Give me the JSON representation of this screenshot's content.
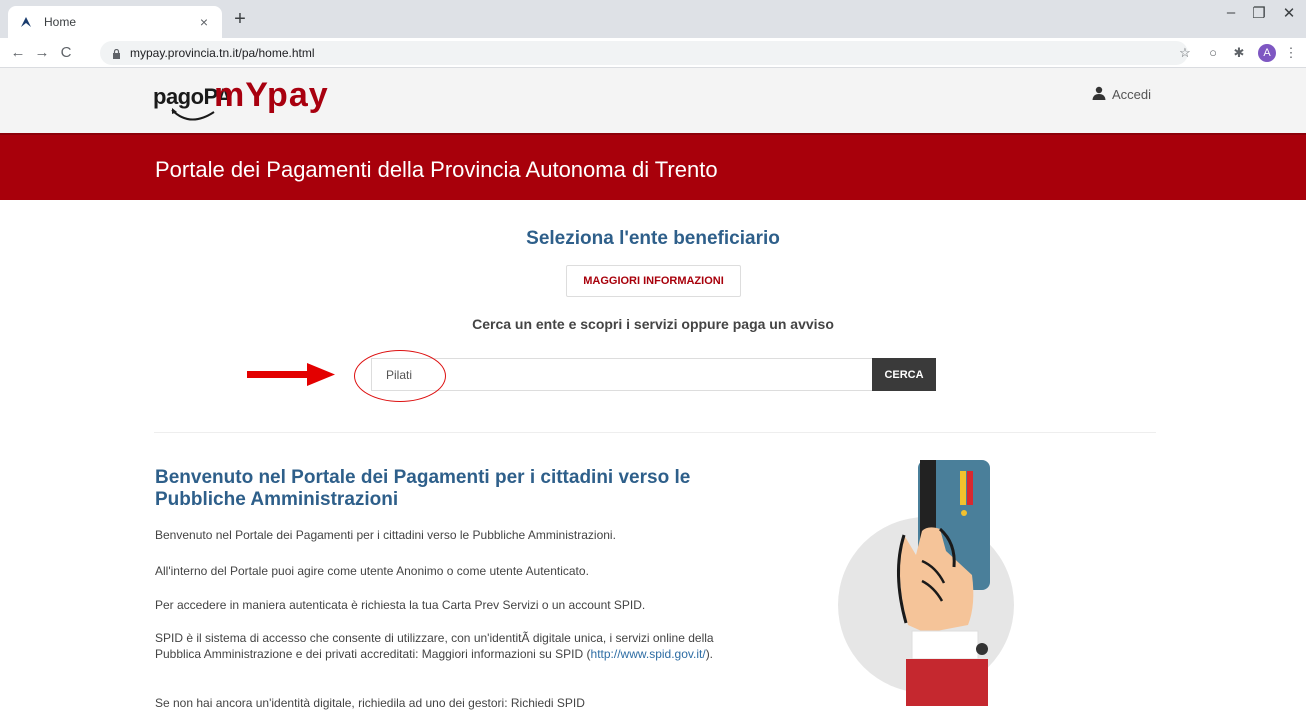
{
  "browser": {
    "tab_title": "Home",
    "tab_close": "×",
    "new_tab": "+",
    "url": "mypay.provincia.tn.it/pa/home.html",
    "profile_initial": "A",
    "minimize": "–",
    "restore": "❐",
    "close": "✕"
  },
  "header": {
    "logo_pagopa": "pagoPA",
    "logo_my": "mY",
    "logo_pay": "pay",
    "login_label": "Accedi"
  },
  "banner": {
    "title": "Portale dei Pagamenti della Provincia Autonoma di Trento"
  },
  "search_section": {
    "title": "Seleziona l'ente beneficiario",
    "info_button": "MAGGIORI INFORMAZIONI",
    "subtitle": "Cerca un ente e scopri i servizi oppure paga un avviso",
    "input_value": "Pilati",
    "search_button": "CERCA"
  },
  "welcome": {
    "title": "Benvenuto nel Portale dei Pagamenti per i cittadini verso le Pubbliche Amministrazioni",
    "p1": "Benvenuto nel Portale dei Pagamenti per i cittadini verso le Pubbliche Amministrazioni.",
    "p2": "All'interno del Portale puoi agire come utente Anonimo o come utente Autenticato.",
    "p3": "Per accedere in maniera autenticata è richiesta la tua Carta Prev Servizi o un account SPID.",
    "p4": "SPID è il sistema di accesso che consente di utilizzare, con un'identitÃ  digitale unica, i servizi online della Pubblica Amministrazione e dei privati accreditati: Maggiori informazioni su SPID (",
    "p4_link": "http://www.spid.gov.it/",
    "p4_end": ").",
    "p5": "Se non hai ancora un'identità digitale, richiedila ad uno dei gestori: Richiedi SPID"
  },
  "colors": {
    "brand_red": "#a8000b",
    "title_blue": "#2e5f8a",
    "button_dark": "#3a3a3a"
  }
}
